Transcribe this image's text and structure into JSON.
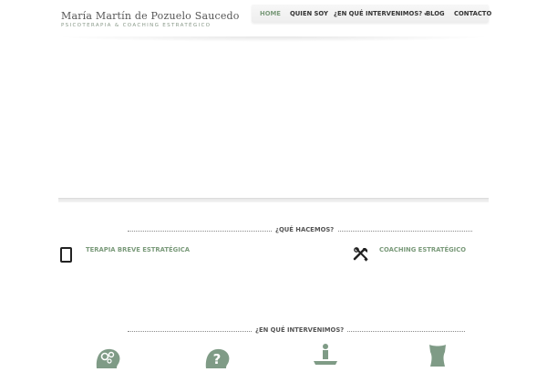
{
  "header": {
    "logo_title": "María Martín de Pozuelo Saucedo",
    "logo_subtitle": "PSICOTERAPIA & COACHING ESTRATÉGICO"
  },
  "nav": {
    "items": [
      {
        "label": "HOME",
        "active": true
      },
      {
        "label": "QUIEN SOY"
      },
      {
        "label": "¿EN QUÉ INTERVENIMOS?",
        "has_dropdown": true
      },
      {
        "label": "BLOG"
      },
      {
        "label": "CONTACTO"
      }
    ],
    "dropdown_caret": "▾"
  },
  "que_hacemos": {
    "title": "¿QUÉ HACEMOS?",
    "features": [
      {
        "title": "TERAPIA BREVE ESTRATÉGICA",
        "icon": "tablet-icon"
      },
      {
        "title": "COACHING ESTRATÉGICO",
        "icon": "tools-icon"
      }
    ]
  },
  "intervenimos": {
    "title": "¿EN QUÉ INTERVENIMOS?",
    "icons": [
      "gears-head-icon",
      "question-head-icon",
      "person-podium-icon",
      "body-icon"
    ]
  },
  "colors": {
    "accent": "#7a9a7a",
    "icon_fill": "#7f9b86",
    "text": "#555555"
  }
}
